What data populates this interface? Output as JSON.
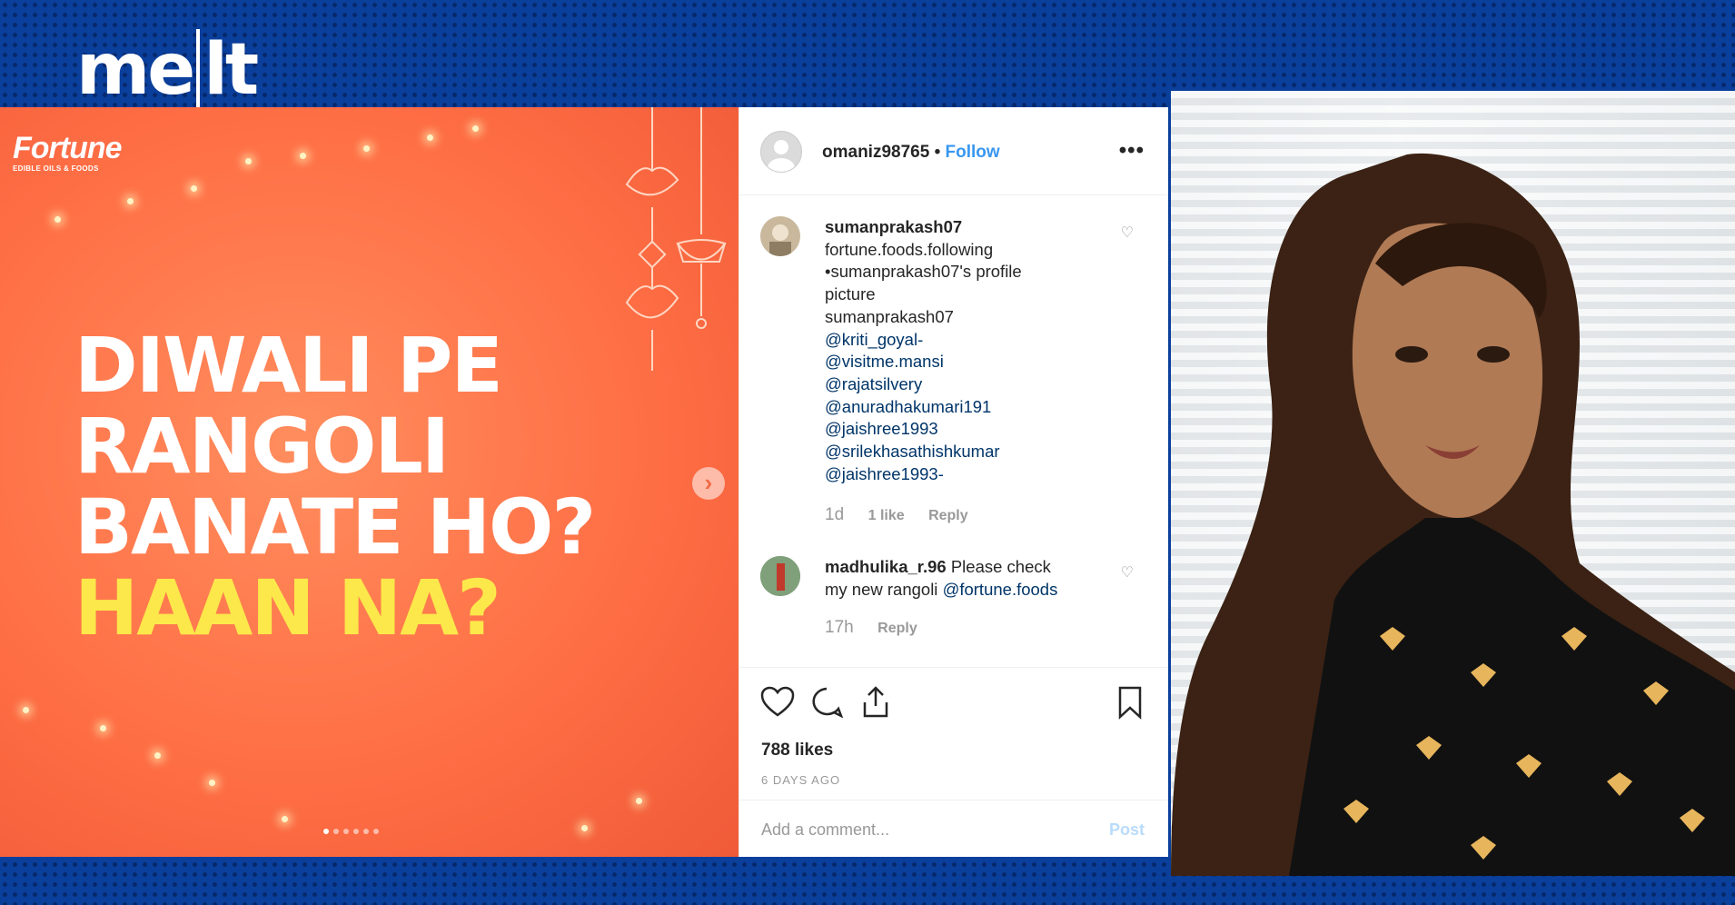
{
  "channel_logo": "melt",
  "post_image": {
    "brand": "Fortune",
    "brand_tagline": "EDIBLE OILS & FOODS",
    "headline_lines": [
      "DIWALI PE",
      "RANGOLI",
      "BANATE HO?"
    ],
    "headline_highlight": "HAAN NA?",
    "carousel_dots": 6,
    "carousel_active": 0
  },
  "post_header": {
    "username": "omaniz98765",
    "separator": "•",
    "follow_label": "Follow",
    "more_label": "•••"
  },
  "comments": [
    {
      "username": "sumanprakash07",
      "lines": [
        {
          "text": "fortune.foods.following",
          "mention": false
        },
        {
          "text": "•sumanprakash07's profile",
          "mention": false
        },
        {
          "text": "picture",
          "mention": false
        },
        {
          "text": "sumanprakash07",
          "mention": false
        },
        {
          "text": "@kriti_goyal-",
          "mention": true
        },
        {
          "text": "@visitme.mansi",
          "mention": true
        },
        {
          "text": "@rajatsilvery",
          "mention": true
        },
        {
          "text": "@anuradhakumari191",
          "mention": true
        },
        {
          "text": "@jaishree1993",
          "mention": true
        },
        {
          "text": "@srilekhasathishkumar",
          "mention": true
        },
        {
          "text": "@jaishree1993-",
          "mention": true
        }
      ],
      "time": "1d",
      "likes": "1 like",
      "reply": "Reply"
    },
    {
      "username": "madhulika_r.96",
      "text_before": "Please check",
      "text_line2": "my new rangoli",
      "mention": "@fortune.foods",
      "time": "17h",
      "reply": "Reply"
    }
  ],
  "actions": {
    "likes": "788 likes",
    "posted": "6 DAYS AGO",
    "comment_placeholder": "Add a comment...",
    "post_button": "Post"
  },
  "colors": {
    "background": "#0a3f9c",
    "post_orange": "#ff7a4f",
    "highlight_yellow": "#fce84a",
    "link_blue": "#3897f0",
    "mention_blue": "#003569"
  }
}
